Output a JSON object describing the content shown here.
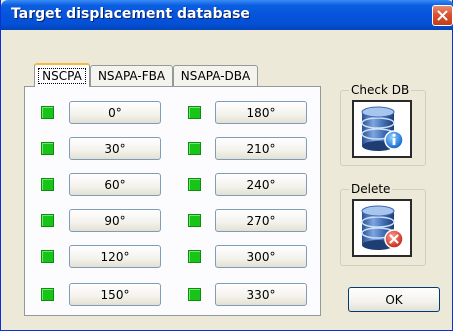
{
  "window": {
    "title": "Target displacement database",
    "titlebar_color": "#0654dd"
  },
  "tabs": [
    {
      "label": "NSCPA",
      "active": true
    },
    {
      "label": "NSAPA-FBA",
      "active": false
    },
    {
      "label": "NSAPA-DBA",
      "active": false
    }
  ],
  "angles": {
    "status_color": "#19c419",
    "left_column": [
      "0°",
      "30°",
      "60°",
      "90°",
      "120°",
      "150°"
    ],
    "right_column": [
      "180°",
      "210°",
      "240°",
      "270°",
      "300°",
      "330°"
    ]
  },
  "check_db": {
    "label": "Check DB",
    "icon": "database-info-icon"
  },
  "delete": {
    "label": "Delete",
    "icon": "database-delete-icon"
  },
  "ok_button": {
    "label": "OK"
  }
}
